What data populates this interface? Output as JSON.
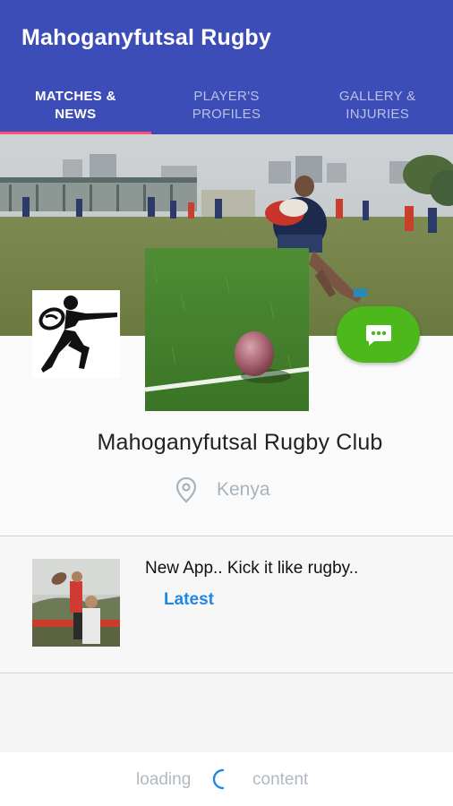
{
  "app": {
    "title": "Mahoganyfutsal Rugby"
  },
  "tabs": [
    {
      "line1": "MATCHES &",
      "line2": "NEWS"
    },
    {
      "line1": "PLAYER'S",
      "line2": "PROFILES"
    },
    {
      "line1": "GALLERY &",
      "line2": "INJURIES"
    }
  ],
  "club": {
    "name": "Mahoganyfutsal Rugby Club",
    "location": "Kenya"
  },
  "news": [
    {
      "title": "New App.. Kick it like rugby..",
      "tag": "Latest"
    }
  ],
  "footer": {
    "loading_left": "loading",
    "loading_right": "content"
  },
  "colors": {
    "app_bar": "#3d4db7",
    "tab_indicator": "#ff4f79",
    "fab_green": "#4cb81c",
    "link_blue": "#1e88e5"
  },
  "icons": {
    "fab": "chat-bubble-icon",
    "location": "location-pin-icon",
    "logo": "rugby-player-logo-icon",
    "spinner": "loading-spinner-icon"
  }
}
